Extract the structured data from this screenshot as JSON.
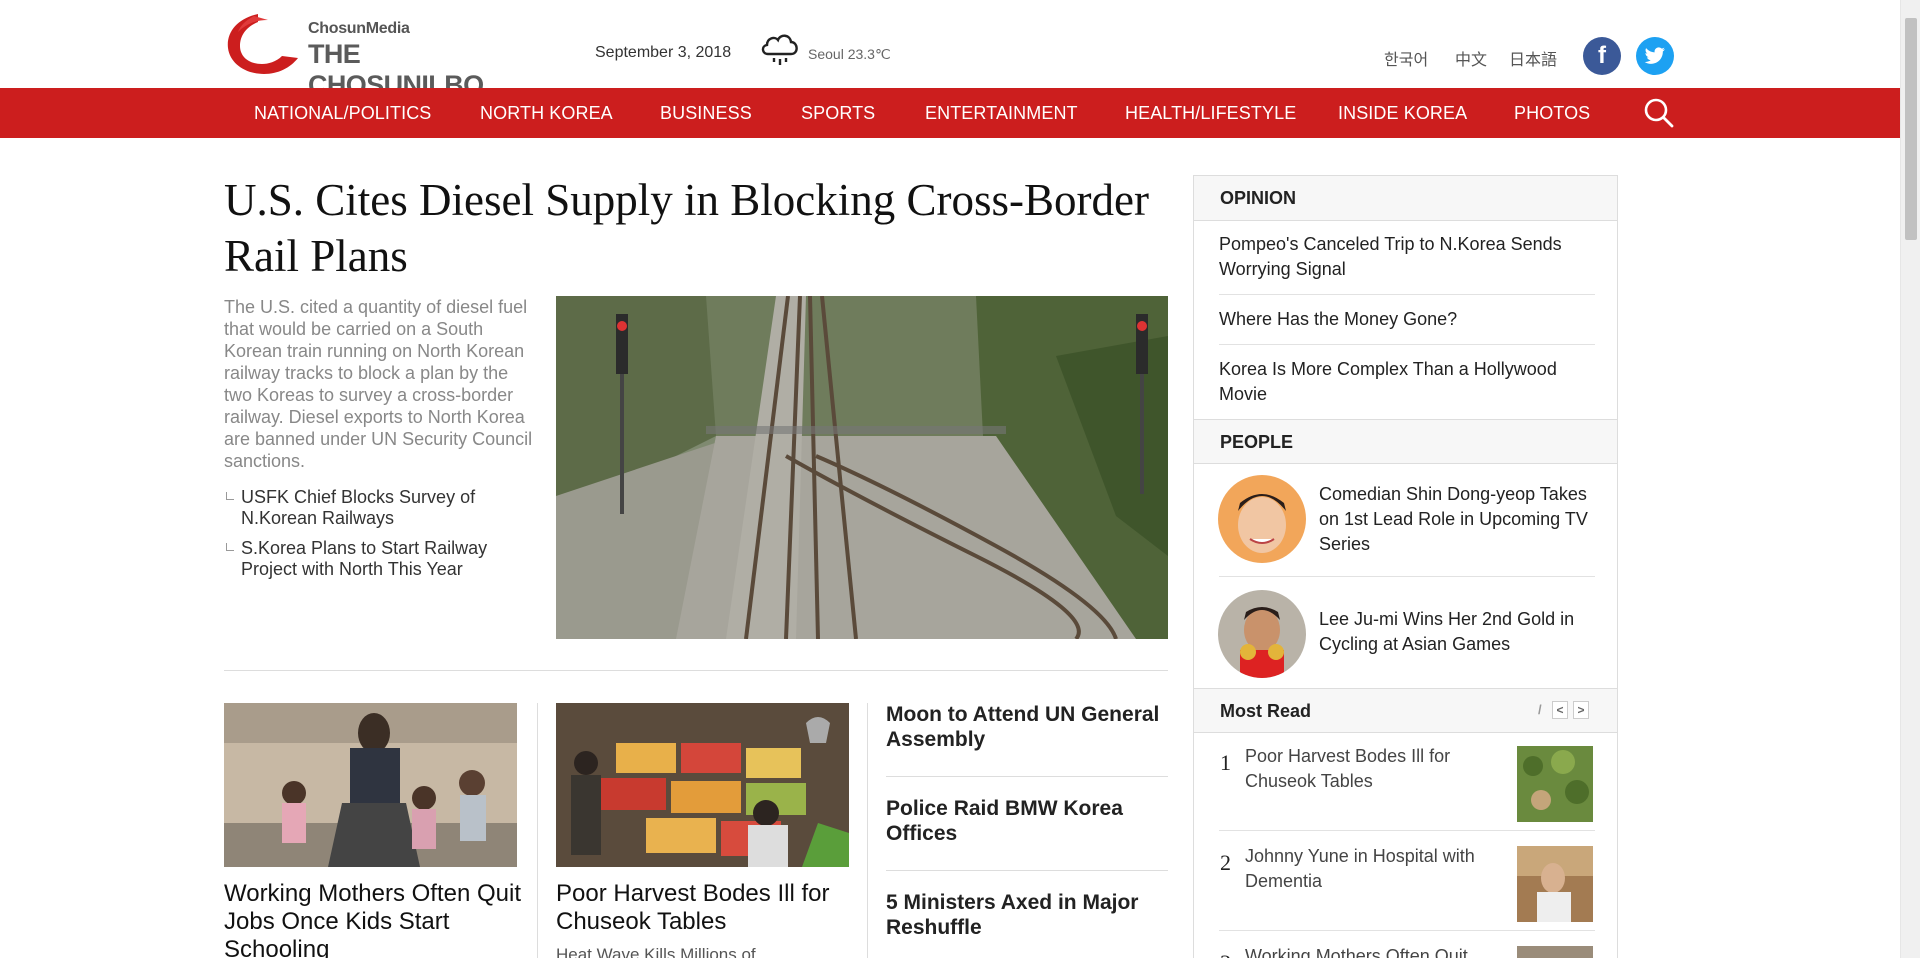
{
  "header": {
    "logo_sub": "ChosunMedia",
    "logo_main": "THE CHOSUNILBO",
    "date": "September 3, 2018",
    "weather": "Seoul 23.3℃",
    "weather_icon": "rain-cloud-icon",
    "languages": [
      "한국어",
      "中文",
      "日本語"
    ],
    "social": {
      "facebook": "f",
      "twitter": "twitter-bird-icon"
    }
  },
  "nav": {
    "items": [
      "NATIONAL/POLITICS",
      "NORTH KOREA",
      "BUSINESS",
      "SPORTS",
      "ENTERTAINMENT",
      "HEALTH/LIFESTYLE",
      "INSIDE KOREA",
      "PHOTOS"
    ],
    "search_icon": "search-icon",
    "color": "#cc1e1e"
  },
  "main_story": {
    "headline": "U.S. Cites Diesel Supply in Blocking Cross-Border Rail Plans",
    "summary": "The U.S. cited a quantity of diesel fuel that would be carried on a South Korean train running on North Korean railway tracks to block a plan by the two Koreas to survey a cross-border railway. Diesel exports to North Korea are banned under UN Security Council sanctions.",
    "related": [
      "USFK Chief Blocks Survey of N.Korean Railways",
      "S.Korea Plans to Start Railway Project with North This Year"
    ]
  },
  "stories": [
    {
      "title": "Working Mothers Often Quit Jobs Once Kids Start Schooling"
    },
    {
      "title": "Poor Harvest Bodes Ill for Chuseok Tables",
      "sub": "Heat Wave Kills Millions of"
    }
  ],
  "news_list": [
    "Moon to Attend UN General Assembly",
    "Police Raid BMW Korea Offices",
    "5 Ministers Axed in Major Reshuffle"
  ],
  "sidebar": {
    "opinion_title": "OPINION",
    "opinion": [
      "Pompeo's Canceled Trip to N.Korea Sends Worrying Signal",
      "Where Has the Money Gone?",
      "Korea Is More Complex Than a Hollywood Movie"
    ],
    "people_title": "PEOPLE",
    "people": [
      "Comedian Shin Dong-yeop Takes on 1st Lead Role in Upcoming TV Series",
      "Lee Ju-mi Wins Her 2nd Gold in Cycling at Asian Games"
    ],
    "most_read_title": "Most Read",
    "most_read_slash": "/",
    "most_read_prev": "<",
    "most_read_next": ">",
    "most_read": [
      {
        "num": "1",
        "title": "Poor Harvest Bodes Ill for Chuseok Tables"
      },
      {
        "num": "2",
        "title": "Johnny Yune in Hospital with Dementia"
      },
      {
        "num": "3",
        "title": "Working Mothers Often Quit"
      }
    ]
  }
}
